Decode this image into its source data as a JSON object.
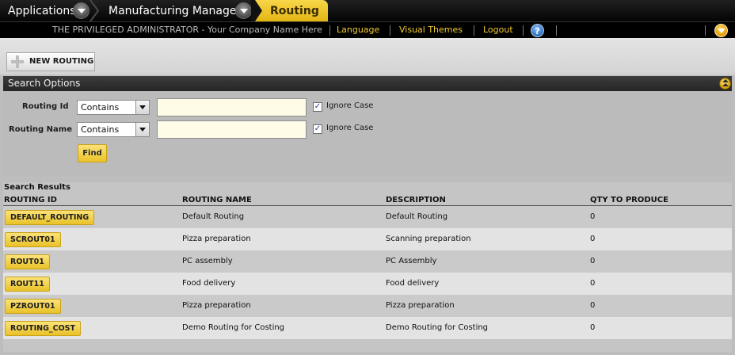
{
  "breadcrumb": {
    "items": [
      {
        "label": "Applications"
      },
      {
        "label": "Manufacturing Manager"
      }
    ],
    "active": "Routing"
  },
  "header": {
    "user_text": "THE PRIVILEGED ADMINISTRATOR - Your Company Name Here",
    "links": [
      "Language",
      "Visual Themes",
      "Logout"
    ],
    "help_glyph": "?"
  },
  "toolbar": {
    "new_routing_label": "NEW ROUTING"
  },
  "search_options": {
    "title": "Search Options",
    "fields": [
      {
        "label": "Routing Id",
        "operator": "Contains",
        "value": "",
        "ignore_case_checked": true,
        "ignore_case_label": "Ignore Case"
      },
      {
        "label": "Routing Name",
        "operator": "Contains",
        "value": "",
        "ignore_case_checked": true,
        "ignore_case_label": "Ignore Case"
      }
    ],
    "find_label": "Find"
  },
  "results": {
    "title": "Search Results",
    "columns": [
      "ROUTING ID",
      "ROUTING NAME",
      "DESCRIPTION",
      "QTY TO PRODUCE"
    ],
    "rows": [
      {
        "id": "DEFAULT_ROUTING",
        "name": "Default Routing",
        "description": "Default Routing",
        "qty": "0"
      },
      {
        "id": "SCROUT01",
        "name": "Pizza preparation",
        "description": "Scanning preparation",
        "qty": "0"
      },
      {
        "id": "ROUT01",
        "name": "PC assembly",
        "description": "PC Assembly",
        "qty": "0"
      },
      {
        "id": "ROUT11",
        "name": "Food delivery",
        "description": "Food delivery",
        "qty": "0"
      },
      {
        "id": "PZROUT01",
        "name": "Pizza preparation",
        "description": "Pizza preparation",
        "qty": "0"
      },
      {
        "id": "ROUTING_COST",
        "name": "Demo Routing for Costing",
        "description": "Demo Routing for Costing",
        "qty": "0"
      }
    ]
  },
  "icons": {
    "crumb_menu": "chevron-down-icon",
    "help": "help-icon",
    "notifications": "notification-icon",
    "collapse": "collapse-icon",
    "new": "plus-icon"
  },
  "colors": {
    "accent": "#eac228",
    "header_bg": "#000000",
    "link": "#f1c92c",
    "input_bg": "#fefce6"
  }
}
